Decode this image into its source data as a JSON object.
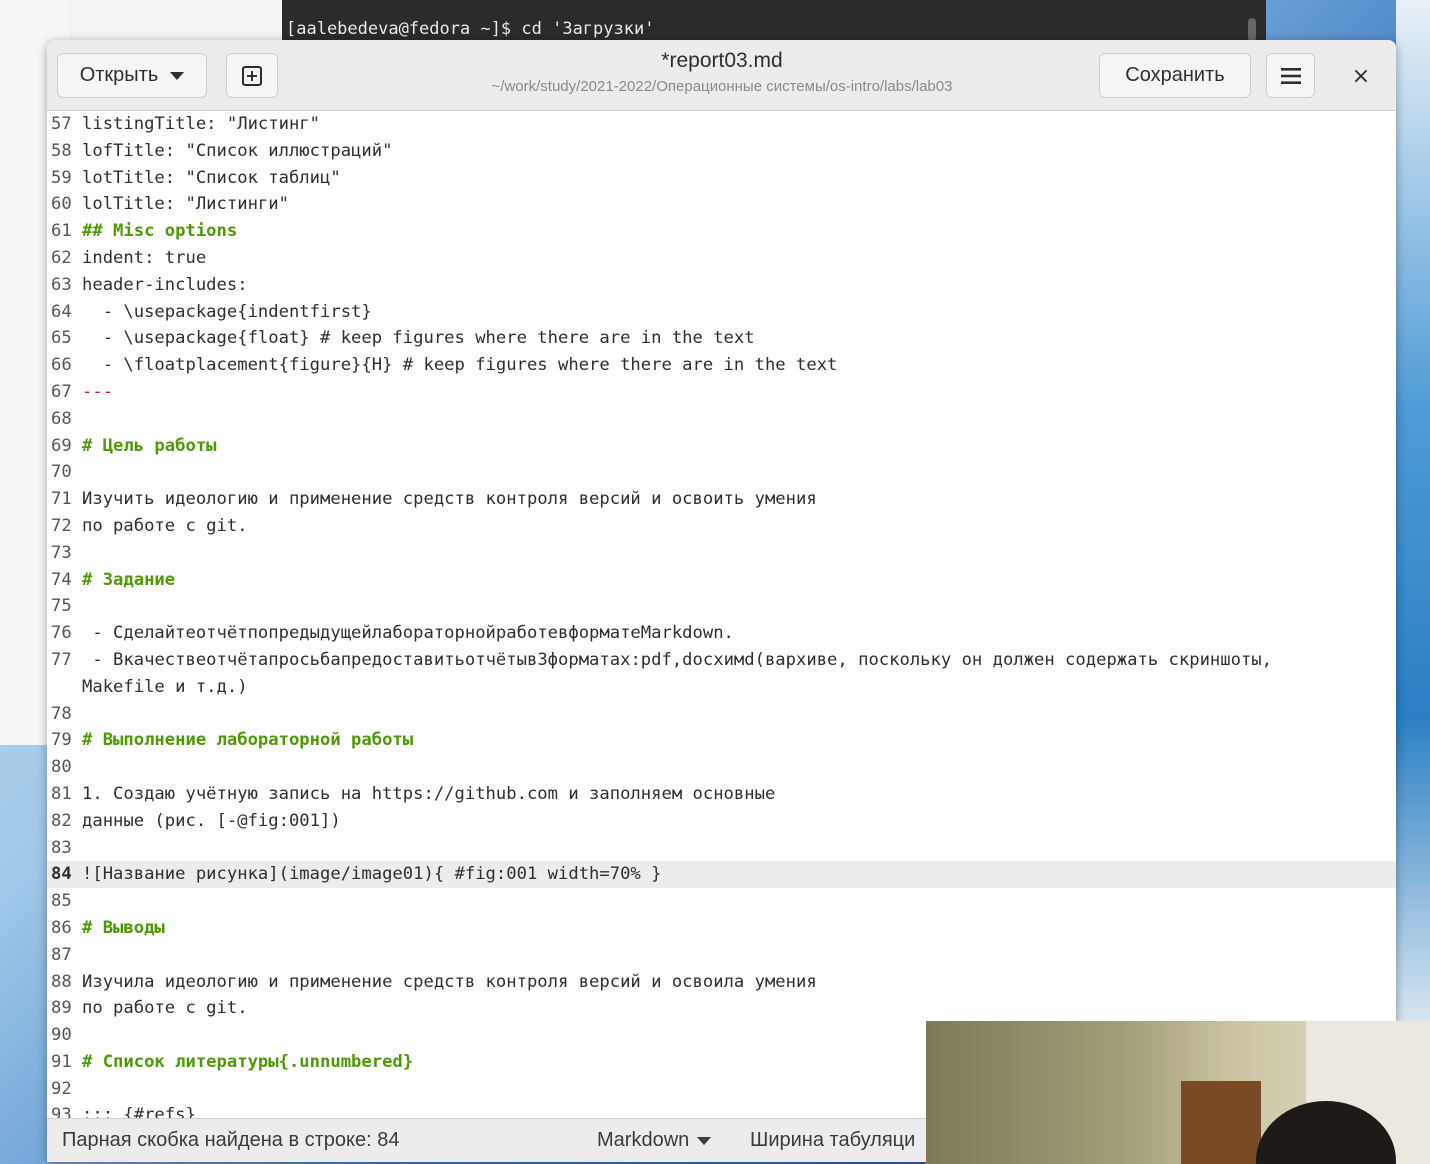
{
  "terminal": {
    "line": "[aalebedeva@fedora ~]$ cd 'Загрузки'"
  },
  "header": {
    "open_label": "Открыть",
    "title": "*report03.md",
    "subtitle": "~/work/study/2021-2022/Операционные системы/os-intro/labs/lab03",
    "save_label": "Сохранить",
    "close_glyph": "×",
    "new_tab_icon": "new-document-icon",
    "menu_icon": "hamburger-menu-icon"
  },
  "editor": {
    "current_line": 84,
    "lines": {
      "57": "listingTitle: \"Листинг\"",
      "58": "lofTitle: \"Список иллюстраций\"",
      "59": "lotTitle: \"Список таблиц\"",
      "60": "lolTitle: \"Листинги\"",
      "61": "## Misc options",
      "62": "indent: true",
      "63": "header-includes:",
      "64": "  - \\usepackage{indentfirst}",
      "65": "  - \\usepackage{float} # keep figures where there are in the text",
      "66": "  - \\floatplacement{figure}{H} # keep figures where there are in the text",
      "67": "---",
      "68": "",
      "69": "# Цель работы",
      "70": "",
      "71": "Изучить идеологию и применение средств контроля версий и освоить умения",
      "72": "по работе с git.",
      "73": "",
      "74": "# Задание",
      "75": "",
      "76": " - СделайтеотчётпопредыдущейлабораторнойработевформатеMarkdown.",
      "77": " - Вкачествеотчётапросьбапредоставитьотчётыв3форматах:pdf,docxимd(вархиве, поскольку он должен содержать скриншоты, Makefile и т.д.)",
      "78": "",
      "79": "# Выполнение лабораторной работы",
      "80": "",
      "81": "1. Создаю учётную запись на https://github.com и заполняем основные",
      "82": "данные (рис. [-@fig:001])",
      "83": "",
      "84": "![Название рисунка](image/image01){ #fig:001 width=70% }",
      "85": "",
      "86": "# Выводы",
      "87": "",
      "88": "Изучила идеологию и применение средств контроля версий и освоила умения",
      "89": "по работе с git.",
      "90": "",
      "91": "# Список литературы{.unnumbered}",
      "92": "",
      "93": "::: {#refs}"
    }
  },
  "status": {
    "message": "Парная скобка найдена в строке: 84",
    "language": "Markdown",
    "tab_width": "Ширина табуляци"
  }
}
